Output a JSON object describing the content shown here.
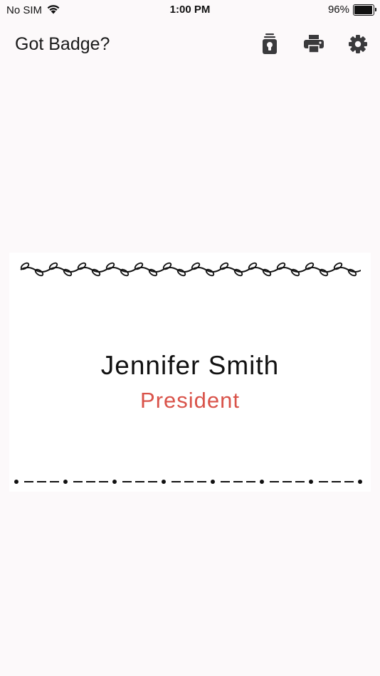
{
  "status_bar": {
    "carrier": "No SIM",
    "time": "1:00 PM",
    "battery_percent": "96%",
    "battery_level": 0.96,
    "wifi_icon": "wifi-icon"
  },
  "nav": {
    "title": "Got Badge?",
    "actions": [
      {
        "icon": "badge-holder-icon"
      },
      {
        "icon": "printer-icon"
      },
      {
        "icon": "gear-icon"
      }
    ]
  },
  "badge": {
    "name": "Jennifer Smith",
    "title": "President",
    "title_color": "#d9534a",
    "top_border_style": "vine-leaves",
    "bottom_border_style": "dot-dash"
  },
  "colors": {
    "background": "#fcf9fa",
    "card": "#ffffff",
    "icon": "#3a3a3c"
  }
}
